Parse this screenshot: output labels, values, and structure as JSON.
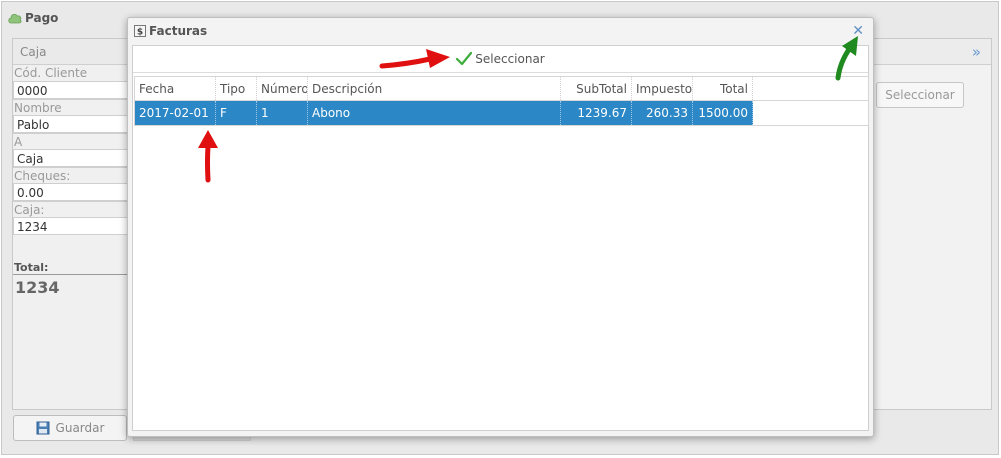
{
  "main": {
    "title": "Pago",
    "left_panel": {
      "header": "Caja",
      "fields": [
        {
          "label": "Cód. Cliente",
          "value": "0000"
        },
        {
          "label": "Nombre",
          "value": "Pablo"
        },
        {
          "label": "A",
          "value": "Caja"
        },
        {
          "label": "Cheques:",
          "value": "0.00"
        },
        {
          "label": "Caja:",
          "value": "1234"
        }
      ],
      "total_label": "Total:",
      "total_value": "1234"
    },
    "right_panel": {
      "select_button": "Seleccionar"
    },
    "save_button": "Guardar"
  },
  "dialog": {
    "title": "Facturas",
    "select_button": "Seleccionar",
    "columns": [
      "Fecha",
      "Tipo",
      "Número",
      "Descripción",
      "SubTotal",
      "Impuestos",
      "Total"
    ],
    "rows": [
      {
        "fecha": "2017-02-01",
        "tipo": "F",
        "numero": "1",
        "descripcion": "Abono",
        "subtotal": "1239.67",
        "impuestos": "260.33",
        "total": "1500.00",
        "selected": true
      }
    ]
  },
  "colors": {
    "selection": "#2b87c5",
    "annotation_red": "#e01010",
    "annotation_green": "#1f8a1f",
    "close_icon": "#5f8fc4"
  },
  "icons": [
    "cloud-icon",
    "double-chevron-right-icon",
    "save-disk-icon",
    "invoice-icon",
    "close-icon",
    "checkmark-icon",
    "red-arrow-icon",
    "green-arrow-icon"
  ]
}
